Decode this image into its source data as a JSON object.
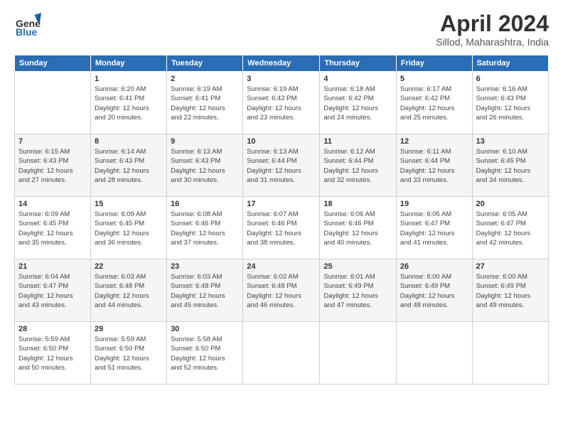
{
  "logo": {
    "general": "General",
    "blue": "Blue"
  },
  "title": "April 2024",
  "location": "Sillod, Maharashtra, India",
  "headers": [
    "Sunday",
    "Monday",
    "Tuesday",
    "Wednesday",
    "Thursday",
    "Friday",
    "Saturday"
  ],
  "weeks": [
    [
      {
        "day": "",
        "info": ""
      },
      {
        "day": "1",
        "info": "Sunrise: 6:20 AM\nSunset: 6:41 PM\nDaylight: 12 hours\nand 20 minutes."
      },
      {
        "day": "2",
        "info": "Sunrise: 6:19 AM\nSunset: 6:41 PM\nDaylight: 12 hours\nand 22 minutes."
      },
      {
        "day": "3",
        "info": "Sunrise: 6:19 AM\nSunset: 6:42 PM\nDaylight: 12 hours\nand 23 minutes."
      },
      {
        "day": "4",
        "info": "Sunrise: 6:18 AM\nSunset: 6:42 PM\nDaylight: 12 hours\nand 24 minutes."
      },
      {
        "day": "5",
        "info": "Sunrise: 6:17 AM\nSunset: 6:42 PM\nDaylight: 12 hours\nand 25 minutes."
      },
      {
        "day": "6",
        "info": "Sunrise: 6:16 AM\nSunset: 6:43 PM\nDaylight: 12 hours\nand 26 minutes."
      }
    ],
    [
      {
        "day": "7",
        "info": "Sunrise: 6:15 AM\nSunset: 6:43 PM\nDaylight: 12 hours\nand 27 minutes."
      },
      {
        "day": "8",
        "info": "Sunrise: 6:14 AM\nSunset: 6:43 PM\nDaylight: 12 hours\nand 28 minutes."
      },
      {
        "day": "9",
        "info": "Sunrise: 6:13 AM\nSunset: 6:43 PM\nDaylight: 12 hours\nand 30 minutes."
      },
      {
        "day": "10",
        "info": "Sunrise: 6:13 AM\nSunset: 6:44 PM\nDaylight: 12 hours\nand 31 minutes."
      },
      {
        "day": "11",
        "info": "Sunrise: 6:12 AM\nSunset: 6:44 PM\nDaylight: 12 hours\nand 32 minutes."
      },
      {
        "day": "12",
        "info": "Sunrise: 6:11 AM\nSunset: 6:44 PM\nDaylight: 12 hours\nand 33 minutes."
      },
      {
        "day": "13",
        "info": "Sunrise: 6:10 AM\nSunset: 6:45 PM\nDaylight: 12 hours\nand 34 minutes."
      }
    ],
    [
      {
        "day": "14",
        "info": "Sunrise: 6:09 AM\nSunset: 6:45 PM\nDaylight: 12 hours\nand 35 minutes."
      },
      {
        "day": "15",
        "info": "Sunrise: 6:09 AM\nSunset: 6:45 PM\nDaylight: 12 hours\nand 36 minutes."
      },
      {
        "day": "16",
        "info": "Sunrise: 6:08 AM\nSunset: 6:46 PM\nDaylight: 12 hours\nand 37 minutes."
      },
      {
        "day": "17",
        "info": "Sunrise: 6:07 AM\nSunset: 6:46 PM\nDaylight: 12 hours\nand 38 minutes."
      },
      {
        "day": "18",
        "info": "Sunrise: 6:06 AM\nSunset: 6:46 PM\nDaylight: 12 hours\nand 40 minutes."
      },
      {
        "day": "19",
        "info": "Sunrise: 6:05 AM\nSunset: 6:47 PM\nDaylight: 12 hours\nand 41 minutes."
      },
      {
        "day": "20",
        "info": "Sunrise: 6:05 AM\nSunset: 6:47 PM\nDaylight: 12 hours\nand 42 minutes."
      }
    ],
    [
      {
        "day": "21",
        "info": "Sunrise: 6:04 AM\nSunset: 6:47 PM\nDaylight: 12 hours\nand 43 minutes."
      },
      {
        "day": "22",
        "info": "Sunrise: 6:03 AM\nSunset: 6:48 PM\nDaylight: 12 hours\nand 44 minutes."
      },
      {
        "day": "23",
        "info": "Sunrise: 6:03 AM\nSunset: 6:48 PM\nDaylight: 12 hours\nand 45 minutes."
      },
      {
        "day": "24",
        "info": "Sunrise: 6:02 AM\nSunset: 6:48 PM\nDaylight: 12 hours\nand 46 minutes."
      },
      {
        "day": "25",
        "info": "Sunrise: 6:01 AM\nSunset: 6:49 PM\nDaylight: 12 hours\nand 47 minutes."
      },
      {
        "day": "26",
        "info": "Sunrise: 6:00 AM\nSunset: 6:49 PM\nDaylight: 12 hours\nand 48 minutes."
      },
      {
        "day": "27",
        "info": "Sunrise: 6:00 AM\nSunset: 6:49 PM\nDaylight: 12 hours\nand 49 minutes."
      }
    ],
    [
      {
        "day": "28",
        "info": "Sunrise: 5:59 AM\nSunset: 6:50 PM\nDaylight: 12 hours\nand 50 minutes."
      },
      {
        "day": "29",
        "info": "Sunrise: 5:59 AM\nSunset: 6:50 PM\nDaylight: 12 hours\nand 51 minutes."
      },
      {
        "day": "30",
        "info": "Sunrise: 5:58 AM\nSunset: 6:50 PM\nDaylight: 12 hours\nand 52 minutes."
      },
      {
        "day": "",
        "info": ""
      },
      {
        "day": "",
        "info": ""
      },
      {
        "day": "",
        "info": ""
      },
      {
        "day": "",
        "info": ""
      }
    ]
  ]
}
